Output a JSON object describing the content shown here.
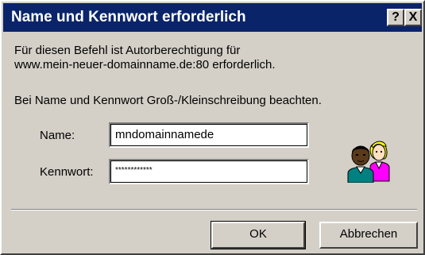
{
  "window": {
    "title": "Name und Kennwort erforderlich",
    "help_glyph": "?",
    "close_glyph": "X"
  },
  "message": {
    "line1": "Für diesen Befehl ist Autorberechtigung für",
    "line2": "www.mein-neuer-domainname.de:80 erforderlich.",
    "hint": "Bei Name und Kennwort Groß-/Kleinschreibung beachten."
  },
  "form": {
    "name_label": "Name:",
    "name_value": "mndomainnamede",
    "password_label": "Kennwort:",
    "password_mask": "************"
  },
  "buttons": {
    "ok": "OK",
    "cancel": "Abbrechen"
  },
  "icons": {
    "users": "users-icon"
  },
  "colors": {
    "titlebar": "#0a246a",
    "face": "#d4d0c8"
  }
}
